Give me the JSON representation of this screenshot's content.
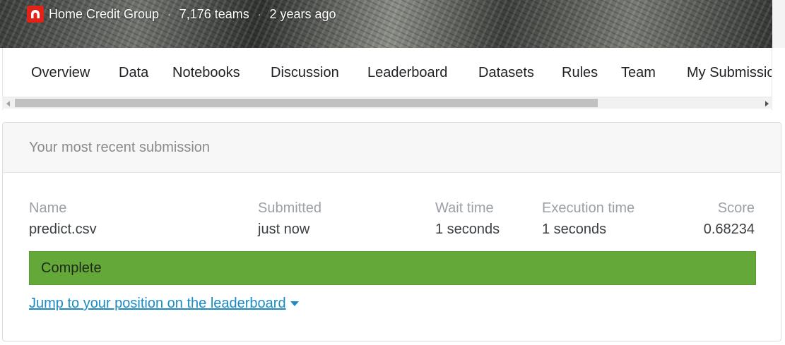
{
  "header": {
    "host_name": "Home Credit Group",
    "teams": "7,176 teams",
    "age": "2 years ago",
    "separator": "·",
    "logo_icon": "home-credit-logo",
    "logo_color": "#e2231a"
  },
  "tabs": [
    {
      "label": "Overview"
    },
    {
      "label": "Data"
    },
    {
      "label": "Notebooks"
    },
    {
      "label": "Discussion"
    },
    {
      "label": "Leaderboard"
    },
    {
      "label": "Datasets"
    },
    {
      "label": "Rules"
    },
    {
      "label": "Team"
    },
    {
      "label": "My Submissions"
    }
  ],
  "submission": {
    "title": "Your most recent submission",
    "columns": {
      "name": "Name",
      "submitted": "Submitted",
      "wait": "Wait time",
      "execution": "Execution time",
      "score": "Score"
    },
    "values": {
      "name": "predict.csv",
      "submitted": "just now",
      "wait": "1 seconds",
      "execution": "1 seconds",
      "score": "0.68234"
    },
    "status": "Complete",
    "status_color": "#64a83a",
    "jump_link": "Jump to your position on the leaderboard",
    "link_color": "#1a8bc4"
  }
}
